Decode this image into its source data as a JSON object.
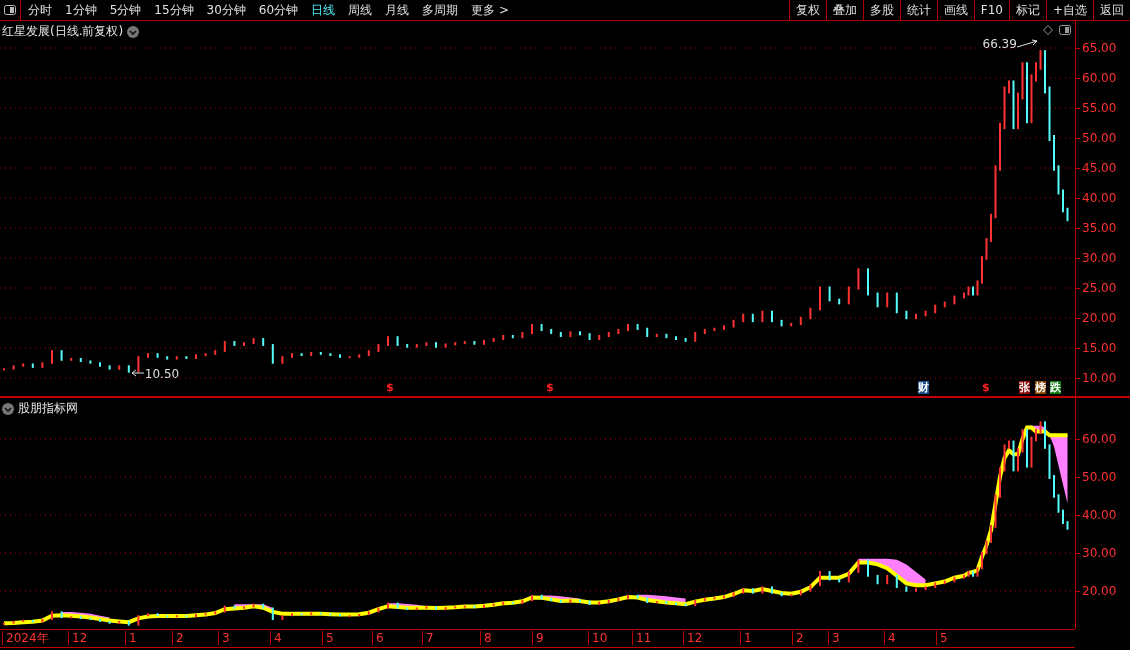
{
  "toolbar": {
    "periods": [
      {
        "label": "分时",
        "selected": false
      },
      {
        "label": "1分钟",
        "selected": false
      },
      {
        "label": "5分钟",
        "selected": false
      },
      {
        "label": "15分钟",
        "selected": false
      },
      {
        "label": "30分钟",
        "selected": false
      },
      {
        "label": "60分钟",
        "selected": false
      },
      {
        "label": "日线",
        "selected": true
      },
      {
        "label": "周线",
        "selected": false
      },
      {
        "label": "月线",
        "selected": false
      },
      {
        "label": "多周期",
        "selected": false
      },
      {
        "label": "更多 >",
        "selected": false
      }
    ],
    "buttons": [
      "复权",
      "叠加",
      "多股",
      "统计",
      "画线",
      "F10",
      "标记",
      "+自选",
      "返回"
    ]
  },
  "main_panel": {
    "title": "红星发展(日线.前复权)",
    "high_label": "66.39",
    "low_label": "10.50",
    "price_axis": [
      "65.00",
      "60.00",
      "55.00",
      "50.00",
      "45.00",
      "40.00",
      "35.00",
      "30.00",
      "25.00",
      "20.00",
      "15.00",
      "10.00"
    ],
    "event_marks": [
      {
        "label": "$",
        "kind": "symbol",
        "color": "#ff2020"
      },
      {
        "label": "$",
        "kind": "symbol",
        "color": "#ff2020"
      },
      {
        "label": "财",
        "kind": "badge",
        "color": "#1d4f8c"
      },
      {
        "label": "$",
        "kind": "symbol",
        "color": "#ff2020"
      },
      {
        "label": "张",
        "kind": "badge",
        "color": "#8c0a0a"
      },
      {
        "label": "榜",
        "kind": "badge",
        "color": "#8c4a00"
      },
      {
        "label": "跌",
        "kind": "badge",
        "color": "#0e7a0e"
      }
    ]
  },
  "indicator_panel": {
    "title": "股朋指标网",
    "price_axis": [
      "60.00",
      "50.00",
      "40.00",
      "30.00",
      "20.00"
    ],
    "time_axis": [
      "2024年",
      "12",
      "1",
      "2",
      "3",
      "4",
      "5",
      "6",
      "7",
      "8",
      "9",
      "10",
      "11",
      "12",
      "1",
      "2",
      "3",
      "4",
      "5"
    ]
  }
}
